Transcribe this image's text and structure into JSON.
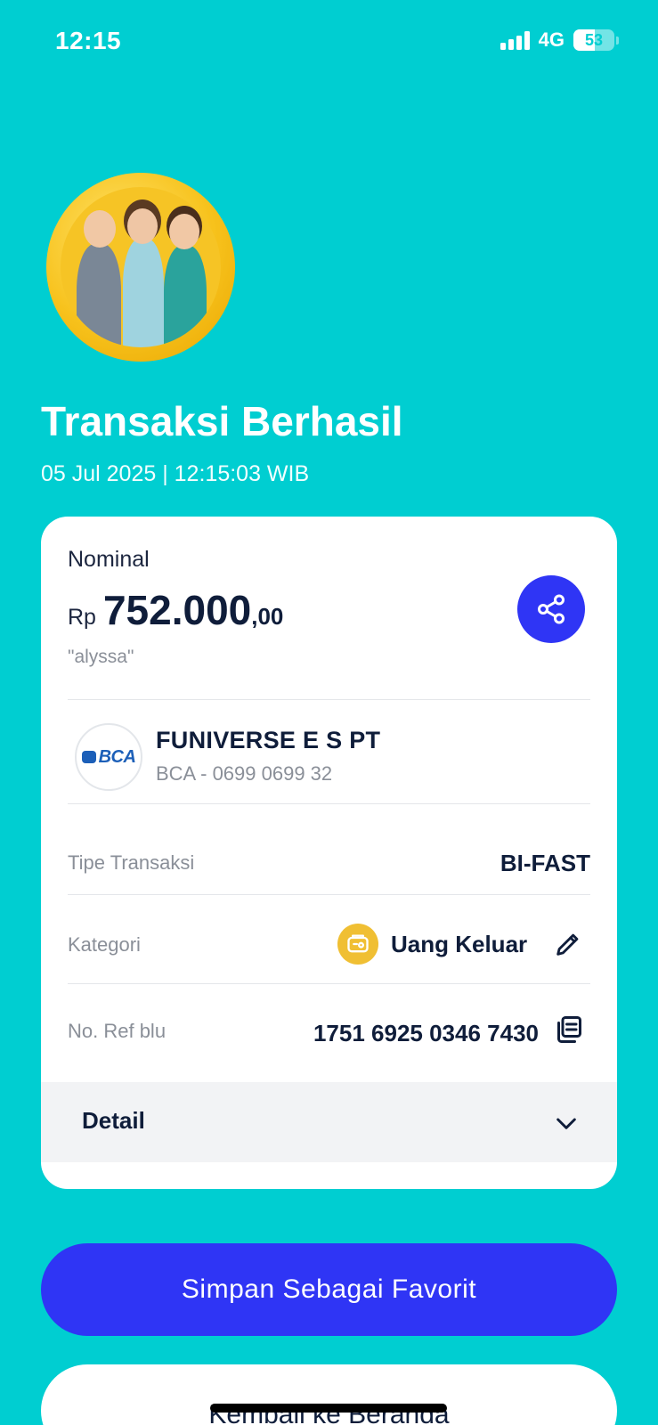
{
  "status_bar": {
    "time": "12:15",
    "network": "4G",
    "battery": "53"
  },
  "header": {
    "title": "Transaksi Berhasil",
    "datetime": "05 Jul 2025 | 12:15:03 WIB"
  },
  "card": {
    "nominal_label": "Nominal",
    "currency": "Rp",
    "amount_main": "752.000",
    "amount_decimal": ",00",
    "note": "\"alyssa\"",
    "recipient": {
      "bank_logo_text": "BCA",
      "name": "FUNIVERSE E S PT",
      "account": "BCA - 0699 0699 32"
    },
    "rows": {
      "type_label": "Tipe Transaksi",
      "type_value": "BI-FAST",
      "category_label": "Kategori",
      "category_value": "Uang Keluar",
      "ref_label": "No. Ref blu",
      "ref_value": "1751 6925 0346 7430"
    },
    "detail_label": "Detail"
  },
  "buttons": {
    "favorite": "Simpan Sebagai Favorit",
    "home": "Kembali ke Beranda"
  },
  "colors": {
    "background": "#00ced1",
    "primary": "#2f35f5",
    "category_icon": "#f0bf33"
  },
  "icons": {
    "share": "share-icon",
    "category": "wallet-icon",
    "edit": "pencil-icon",
    "copy": "copy-icon",
    "detail": "chevron-down-icon"
  }
}
